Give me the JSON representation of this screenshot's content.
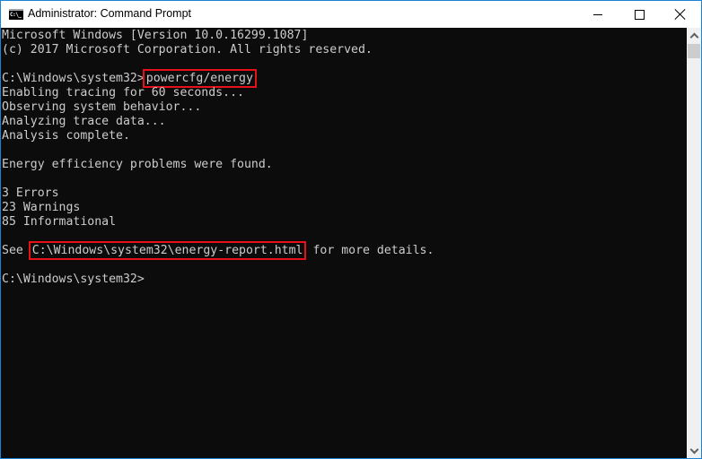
{
  "window": {
    "title": "Administrator: Command Prompt",
    "icon": "cmd-icon",
    "icon_text": "C:\\_",
    "controls": {
      "minimize": "minimize-icon",
      "maximize": "maximize-icon",
      "close": "close-icon"
    }
  },
  "console": {
    "lines": [
      {
        "text": "Microsoft Windows [Version 10.0.16299.1087]"
      },
      {
        "text": "(c) 2017 Microsoft Corporation. All rights reserved."
      },
      {
        "text": ""
      },
      {
        "prompt": "C:\\Windows\\system32>",
        "command": "powercfg/energy",
        "highlighted": true
      },
      {
        "text": "Enabling tracing for 60 seconds..."
      },
      {
        "text": "Observing system behavior..."
      },
      {
        "text": "Analyzing trace data..."
      },
      {
        "text": "Analysis complete."
      },
      {
        "text": ""
      },
      {
        "text": "Energy efficiency problems were found."
      },
      {
        "text": ""
      },
      {
        "text": "3 Errors"
      },
      {
        "text": "23 Warnings"
      },
      {
        "text": "85 Informational"
      },
      {
        "text": ""
      },
      {
        "before": "See",
        "path": "C:\\Windows\\system32\\energy-report.html",
        "after": "for more details.",
        "highlighted": true
      },
      {
        "text": ""
      },
      {
        "prompt": "C:\\Windows\\system32>"
      }
    ],
    "summary": {
      "errors": 3,
      "warnings": 23,
      "informational": 85,
      "tracing_seconds": 60
    }
  },
  "scrollbar": {
    "up_icon": "chevron-up-icon",
    "down_icon": "chevron-down-icon"
  },
  "colors": {
    "console_bg": "#0c0c0c",
    "console_text": "#cccccc",
    "highlight_box": "#e8111a",
    "window_border": "#1883d7"
  }
}
